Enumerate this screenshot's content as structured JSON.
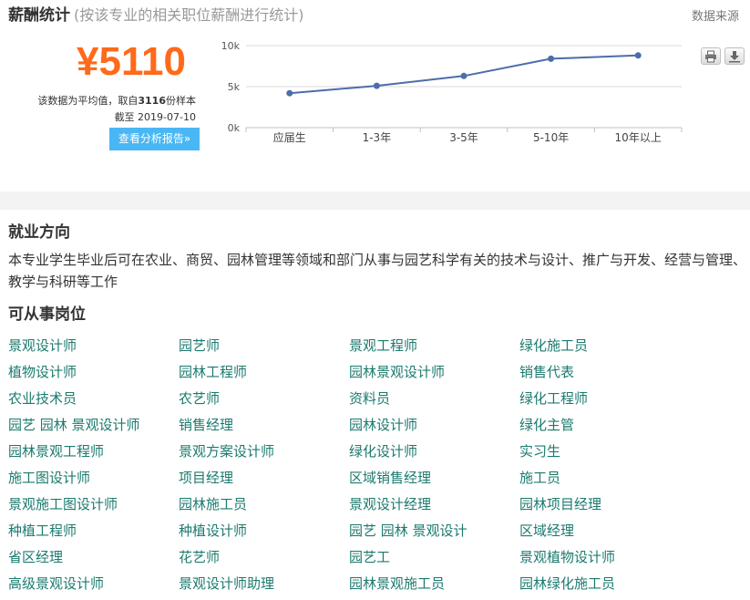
{
  "salary": {
    "title": "薪酬统计",
    "subtitle": "(按该专业的相关职位薪酬进行统计)",
    "source_link": "数据来源",
    "value": "¥5110",
    "note_prefix": "该数据为平均值，取自",
    "sample_count": "3116",
    "note_suffix": "份样本",
    "date_line": "截至 2019-07-10",
    "report_button": "查看分析报告»"
  },
  "chart_data": {
    "type": "line",
    "categories": [
      "应届生",
      "1-3年",
      "3-5年",
      "5-10年",
      "10年以上"
    ],
    "values": [
      4200,
      5100,
      6300,
      8400,
      8800
    ],
    "yticks": [
      {
        "value": 0,
        "label": "0k"
      },
      {
        "value": 5000,
        "label": "5k"
      },
      {
        "value": 10000,
        "label": "10k"
      }
    ],
    "ylim": [
      0,
      10000
    ],
    "grid": true,
    "legend": "none",
    "color": "#4a6ea9"
  },
  "employment": {
    "title": "就业方向",
    "description": "本专业学生毕业后可在农业、商贸、园林管理等领域和部门从事与园艺科学有关的技术与设计、推广与开发、经营与管理、教学与科研等工作"
  },
  "jobs": {
    "title": "可从事岗位",
    "items": [
      "景观设计师",
      "园艺师",
      "景观工程师",
      "绿化施工员",
      "植物设计师",
      "园林工程师",
      "园林景观设计师",
      "销售代表",
      "农业技术员",
      "农艺师",
      "资料员",
      "绿化工程师",
      "园艺 园林 景观设计师",
      "销售经理",
      "园林设计师",
      "绿化主管",
      "园林景观工程师",
      "景观方案设计师",
      "绿化设计师",
      "实习生",
      "施工图设计师",
      "项目经理",
      "区域销售经理",
      "施工员",
      "景观施工图设计师",
      "园林施工员",
      "景观设计经理",
      "园林项目经理",
      "种植工程师",
      "种植设计师",
      "园艺 园林 景观设计",
      "区域经理",
      "省区经理",
      "花艺师",
      "园艺工",
      "景观植物设计师",
      "高级景观设计师",
      "景观设计师助理",
      "园林景观施工员",
      "园林绿化施工员"
    ]
  },
  "colors": {
    "accent": "#ff6a1a",
    "button": "#4ab7f5",
    "link": "#1b7a6e"
  },
  "icons": {
    "print": "print-icon",
    "download": "download-icon"
  }
}
